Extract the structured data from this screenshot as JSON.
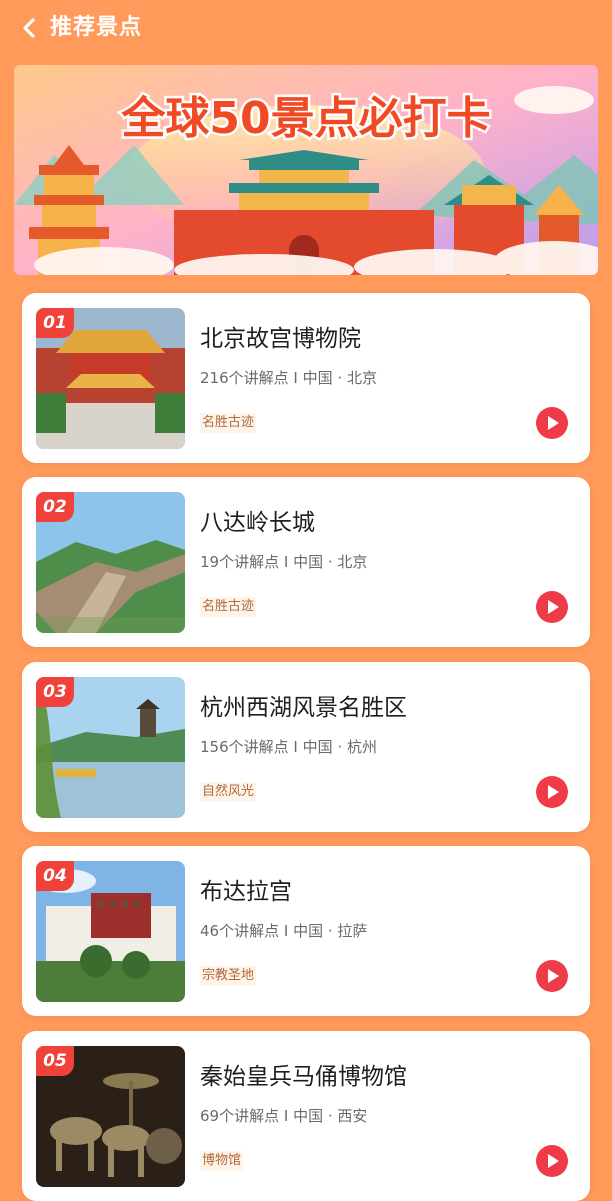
{
  "header": {
    "title": "推荐景点"
  },
  "banner": {
    "headline": "全球50景点必打卡"
  },
  "spots": [
    {
      "rank": "01",
      "name": "北京故宫博物院",
      "points": "216个讲解点",
      "separator": "I",
      "location": "中国 · 北京",
      "tag": "名胜古迹"
    },
    {
      "rank": "02",
      "name": "八达岭长城",
      "points": "19个讲解点",
      "separator": "I",
      "location": "中国 · 北京",
      "tag": "名胜古迹"
    },
    {
      "rank": "03",
      "name": "杭州西湖风景名胜区",
      "points": "156个讲解点",
      "separator": "I",
      "location": "中国 · 杭州",
      "tag": "自然风光"
    },
    {
      "rank": "04",
      "name": "布达拉宫",
      "points": "46个讲解点",
      "separator": "I",
      "location": "中国 · 拉萨",
      "tag": "宗教圣地"
    },
    {
      "rank": "05",
      "name": "秦始皇兵马俑博物馆",
      "points": "69个讲解点",
      "separator": "I",
      "location": "中国 · 西安",
      "tag": "博物馆"
    }
  ],
  "icons": {
    "back": "chevron-left-icon",
    "play": "play-icon"
  },
  "colors": {
    "background": "#FF9A5A",
    "rank_badge": "#F0413A",
    "play_button": "#EE3B47",
    "tag_text": "#B06A3A"
  }
}
